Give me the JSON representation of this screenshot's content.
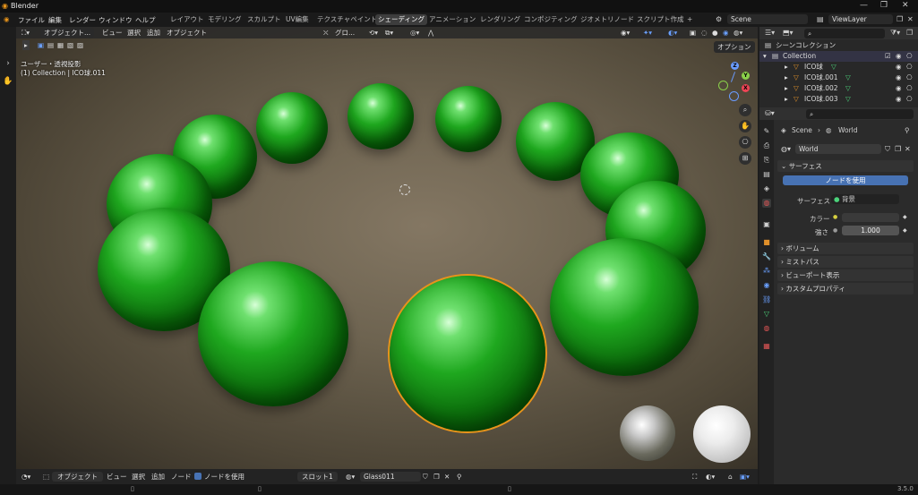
{
  "app": {
    "title": "Blender"
  },
  "window_controls": [
    "—",
    "❐",
    "✕"
  ],
  "menu": [
    "ファイル",
    "編集",
    "レンダー",
    "ウィンドウ",
    "ヘルプ"
  ],
  "workspaces": [
    "レイアウト",
    "モデリング",
    "スカルプト",
    "UV編集",
    "テクスチャペイント",
    "シェーディング",
    "アニメーション",
    "レンダリング",
    "コンポジティング",
    "ジオメトリノード",
    "スクリプト作成"
  ],
  "workspace_add": "+",
  "active_workspace": "シェーディング",
  "scene_field": "Scene",
  "viewlayer_field": "ViewLayer",
  "viewport_header": {
    "mode": "オブジェクト...",
    "menus": [
      "ビュー",
      "選択",
      "追加",
      "オブジェクト"
    ],
    "orientation": "グロ...",
    "options": "オプション"
  },
  "viewport_overlay": {
    "view_name": "ユーザー・透視投影",
    "collection_info": "(1) Collection | ICO球.011"
  },
  "gizmo": {
    "x": "X",
    "y": "Y",
    "z": "Z"
  },
  "nav_icons": [
    "zoom-icon",
    "hand-icon",
    "camera-icon",
    "grid-icon"
  ],
  "bottom_bar": {
    "mode": "オブジェクト",
    "menus": [
      "ビュー",
      "選択",
      "追加",
      "ノード"
    ],
    "use_nodes": "ノードを使用",
    "slot": "スロット1",
    "material": "Glass011"
  },
  "outliner": {
    "title": "シーンコレクション",
    "collection": "Collection",
    "items": [
      "ICO球",
      "ICO球.001",
      "ICO球.002",
      "ICO球.003"
    ]
  },
  "properties": {
    "breadcrumb_scene": "Scene",
    "breadcrumb_world": "World",
    "world_name": "World",
    "surface_panel": "サーフェス",
    "use_nodes_button": "ノードを使用",
    "surface_label": "サーフェス",
    "surface_value": "背景",
    "color_label": "カラー",
    "strength_label": "強さ",
    "strength_value": "1.000",
    "panels": [
      "ボリューム",
      "ミストパス",
      "ビューポート表示",
      "カスタムプロパティ"
    ]
  },
  "status": {
    "version": "3.5.0"
  },
  "colors": {
    "accent_blue": "#4772b3",
    "selected_outline": "#e8941a",
    "sphere_green": "#1fa81f"
  }
}
